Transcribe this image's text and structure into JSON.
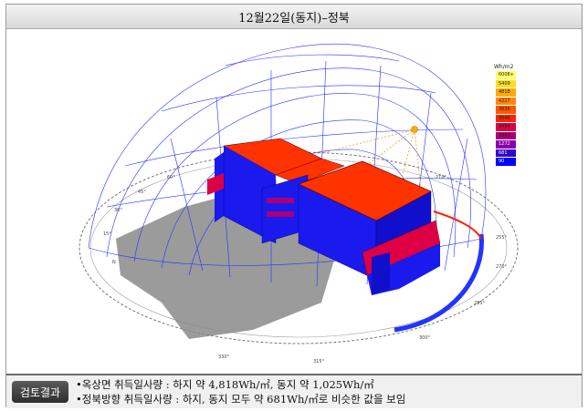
{
  "header": {
    "title": "12월22일(동지)–정북"
  },
  "legend": {
    "unit": "Wh/m2",
    "entries": [
      {
        "label": "6008+",
        "color": "#ffff66"
      },
      {
        "label": "5409",
        "color": "#ffdd22"
      },
      {
        "label": "4818",
        "color": "#ffaa00"
      },
      {
        "label": "4227",
        "color": "#ff8800"
      },
      {
        "label": "3636",
        "color": "#ff5500"
      },
      {
        "label": "3046",
        "color": "#ff2200"
      },
      {
        "label": "2454",
        "color": "#dd0044"
      },
      {
        "label": "1863",
        "color": "#aa0077"
      },
      {
        "label": "1272",
        "color": "#8800aa"
      },
      {
        "label": "681",
        "color": "#3300cc"
      },
      {
        "label": "90",
        "color": "#0000ff"
      }
    ]
  },
  "compass": {
    "labels": [
      "N",
      "15°",
      "30°",
      "45°",
      "60°",
      "210°",
      "255°",
      "270°",
      "285°",
      "300°",
      "315°",
      "330°"
    ]
  },
  "result": {
    "label": "검토결과",
    "line1": "•옥상면 취득일사량 : 하지 약 4,818Wh/㎡, 동지 약 1,025Wh/㎡",
    "line2": "•정북방향 취득일사량 : 하지, 동지 모두 약 681Wh/㎡로 비슷한 값을 보임"
  },
  "colors": {
    "sunpath": "#2233ff",
    "roof": "#ff3300",
    "wall": "#1a1aee",
    "shadow": "#8a8a8a"
  }
}
